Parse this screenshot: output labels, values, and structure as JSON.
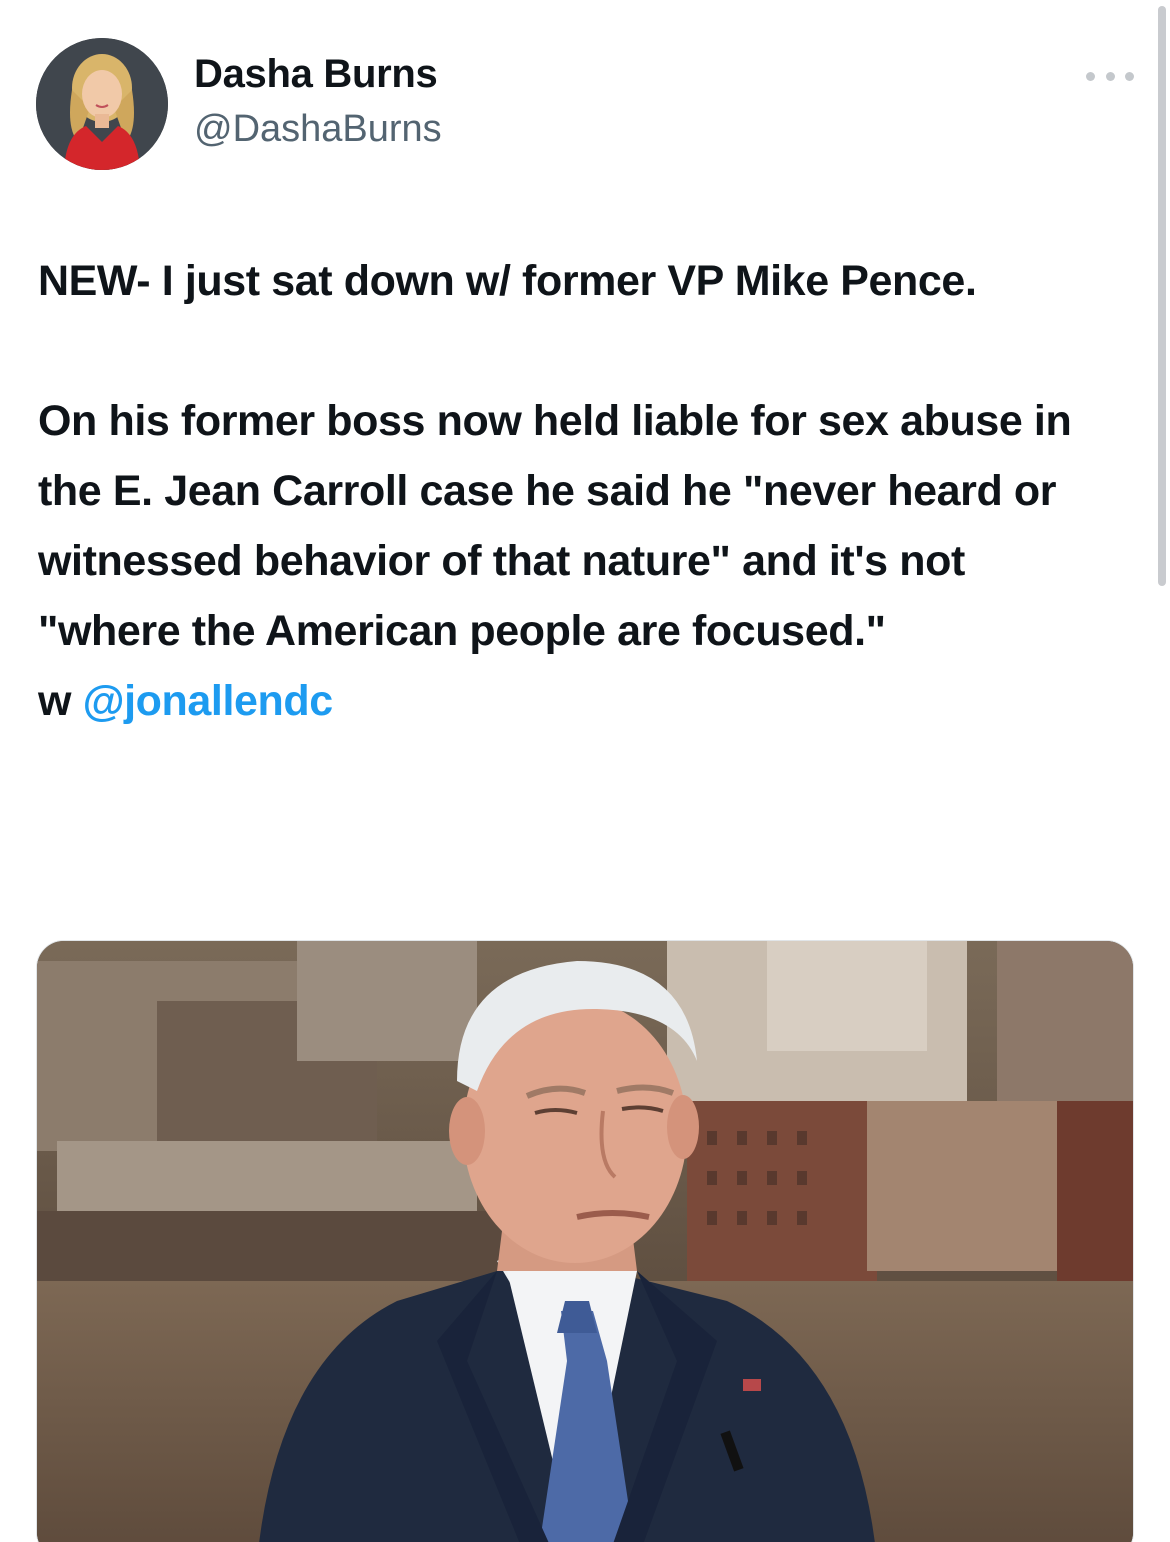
{
  "author": {
    "display_name": "Dasha Burns",
    "handle": "@DashaBurns",
    "avatar_icon": "profile-photo"
  },
  "menu": {
    "more_icon": "more-horizontal-icon"
  },
  "tweet": {
    "paragraph_1": "NEW- I just sat down w/ former VP Mike Pence.",
    "paragraph_2": "On his former boss now held liable for sex abuse in the E. Jean Carroll case he said he \"never heard or witnessed behavior of that nature\" and it's not \"where the American people are focused.\"",
    "with_prefix": "w",
    "mention": "@jonallendc"
  },
  "media": {
    "image_icon": "photo-of-mike-pence"
  },
  "colors": {
    "text": "#0f1419",
    "secondary": "#536471",
    "link": "#1d9bf0"
  }
}
